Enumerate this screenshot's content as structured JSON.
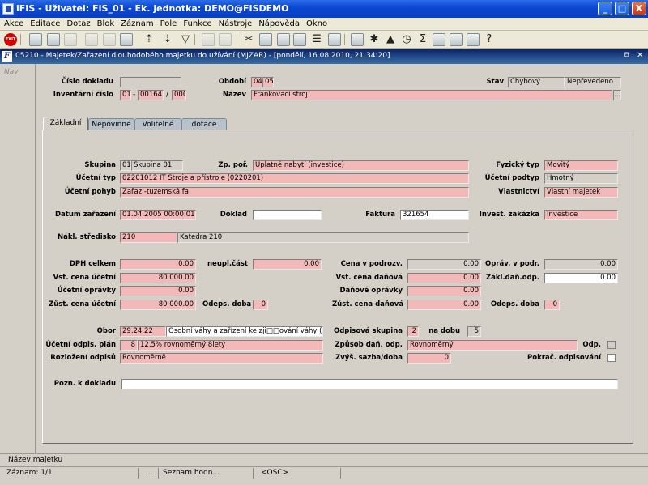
{
  "titlebar": {
    "title": "iFIS - Uživatel: FIS_01 - Ek. jednotka: DEMO@FISDEMO",
    "min": "_",
    "max": "□",
    "close": "X"
  },
  "menu": [
    "Akce",
    "Editace",
    "Dotaz",
    "Blok",
    "Záznam",
    "Pole",
    "Funkce",
    "Nástroje",
    "Nápověda",
    "Okno"
  ],
  "toolbar": {
    "exit_label": "EXIT"
  },
  "subwindow": {
    "title": "05210 - Majetek/Zařazení dlouhodobého majetku do užívání (MJZAR) - [pondělí, 16.08.2010, 21:34:20]",
    "icon_letter": "F"
  },
  "nav": {
    "label": "Nav"
  },
  "header": {
    "cislo_dokladu_label": "Číslo dokladu",
    "cislo_dokladu": "",
    "obdobi_label": "Období",
    "obdobi_1": "04",
    "obdobi_2": "05",
    "stav_label": "Stav",
    "stav_1": "Chybový",
    "stav_2": "Nepřevedeno",
    "inventarni_label": "Inventární číslo",
    "inv_1": "01",
    "inv_2": "00164",
    "inv_3": "000",
    "dash": "-",
    "slash": "/",
    "nazev_label": "Název",
    "nazev": "Frankovací stroj",
    "lov": "..."
  },
  "tabs": [
    "Základní",
    "Nepovinné",
    "Volitelné",
    "dotace"
  ],
  "form": {
    "skupina_label": "Skupina",
    "skupina_code": "01",
    "skupina_name": "Skupina 01",
    "zp_por_label": "Zp. poř.",
    "zp_por": "Úplatné nabytí (investice)",
    "fyzicky_typ_label": "Fyzický typ",
    "fyzicky_typ": "Movitý",
    "ucetni_typ_label": "Účetní typ",
    "ucetni_typ": "02201012 IT Stroje a přístroje (0220201)",
    "ucetni_podtyp_label": "Účetní podtyp",
    "ucetni_podtyp": "Hmotný",
    "ucetni_pohyb_label": "Účetní pohyb",
    "ucetni_pohyb": "Zařaz.-tuzemská fa",
    "vlastnictvi_label": "Vlastnictví",
    "vlastnictvi": "Vlastní majetek",
    "datum_label": "Datum zařazení",
    "datum": "01.04.2005 00:00:01",
    "doklad_label": "Doklad",
    "doklad": "",
    "faktura_label": "Faktura",
    "faktura": "321654",
    "invest_label": "Invest. zakázka",
    "invest": "Investice",
    "stredisko_label": "Nákl. středisko",
    "stredisko_code": "210",
    "stredisko_name": "Katedra 210",
    "dph_label": "DPH celkem",
    "dph": "0.00",
    "neupl_label": "neupl.část",
    "neupl": "0.00",
    "cena_podroz_label": "Cena v podrozv.",
    "cena_podroz": "0.00",
    "oprav_podr_label": "Opráv. v podr.",
    "oprav_podr": "0.00",
    "vst_ucetni_label": "Vst. cena účetní",
    "vst_ucetni": "80 000.00",
    "vst_danova_label": "Vst. cena daňová",
    "vst_danova": "0.00",
    "zakl_dan_label": "Zákl.daň.odp.",
    "zakl_dan": "0.00",
    "ucetni_opravky_label": "Účetní oprávky",
    "ucetni_opravky": "0.00",
    "danove_opravky_label": "Daňové oprávky",
    "danove_opravky": "0.00",
    "zust_ucetni_label": "Zůst. cena účetní",
    "zust_ucetni": "80 000.00",
    "odeps_doba1_label": "Odeps. doba",
    "odeps_doba1": "0",
    "zust_danova_label": "Zůst. cena daňová",
    "zust_danova": "0.00",
    "odeps_doba2_label": "Odeps. doba",
    "odeps_doba2": "0",
    "obor_label": "Obor",
    "obor_code": "29.24.22",
    "obor_name": "Osobní váhy a zařízení ke zji□□ování váhy (29.24",
    "odpis_skup_label": "Odpisová skupina",
    "odpis_skup": "2",
    "na_dobu_label": "na dobu",
    "na_dobu": "5",
    "ucetni_plan_label": "Účetní odpis. plán",
    "ucetni_plan_code": "8",
    "ucetni_plan_name": "12,5% rovnoměrný 8letý",
    "zpusob_label": "Způsob daň. odp.",
    "zpusob": "Rovnoměrný",
    "odp_label": "Odp.",
    "rozlozeni_label": "Rozložení odpisů",
    "rozlozeni": "Rovnoměrně",
    "zvys_label": "Zvýš. sazba/doba",
    "zvys": "0",
    "pokrac_label": "Pokrač. odpisování",
    "pozn_label": "Pozn. k dokladu",
    "pozn": ""
  },
  "status": {
    "field_name": "Název majetku",
    "zaznam": "Záznam: 1/1",
    "dots": "...",
    "seznam": "Seznam hodn...",
    "osc": "<OSC>"
  }
}
